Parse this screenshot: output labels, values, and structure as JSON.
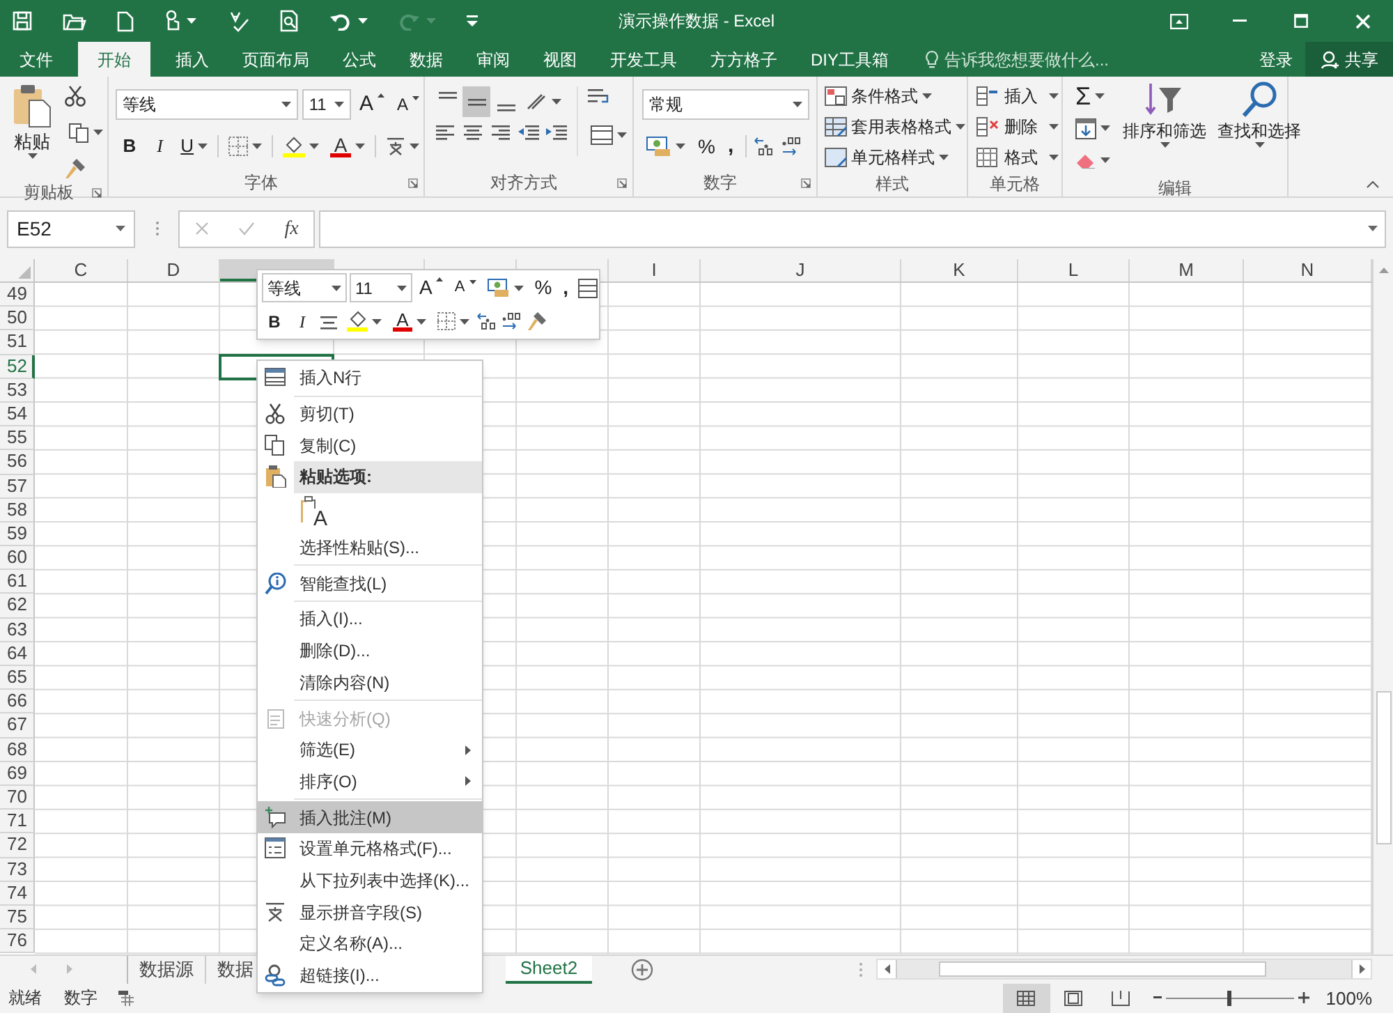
{
  "window": {
    "title": "演示操作数据 - Excel"
  },
  "ribbon_tabs": [
    {
      "label": "文件",
      "selected": false
    },
    {
      "label": "开始",
      "selected": true
    },
    {
      "label": "插入",
      "selected": false
    },
    {
      "label": "页面布局",
      "selected": false
    },
    {
      "label": "公式",
      "selected": false
    },
    {
      "label": "数据",
      "selected": false
    },
    {
      "label": "审阅",
      "selected": false
    },
    {
      "label": "视图",
      "selected": false
    },
    {
      "label": "开发工具",
      "selected": false
    },
    {
      "label": "方方格子",
      "selected": false
    },
    {
      "label": "DIY工具箱",
      "selected": false
    }
  ],
  "tell_me": {
    "placeholder": "告诉我您想要做什么..."
  },
  "account": {
    "sign_in": "登录",
    "share": "共享"
  },
  "ribbon": {
    "clipboard": {
      "label": "剪贴板",
      "paste": "粘贴"
    },
    "font": {
      "label": "字体",
      "font_name": "等线",
      "font_size": "11",
      "grow": "A",
      "shrink": "A",
      "bold": "B",
      "italic": "I",
      "underline": "U",
      "font_color": "A"
    },
    "alignment": {
      "label": "对齐方式",
      "vertical": [
        {
          "selected": false
        },
        {
          "selected": true
        },
        {
          "selected": false
        }
      ]
    },
    "number": {
      "label": "数字",
      "format": "常规",
      "percent": "%",
      "comma": ","
    },
    "styles": {
      "label": "样式",
      "buttons": [
        "条件格式",
        "套用表格格式",
        "单元格样式"
      ]
    },
    "cells": {
      "label": "单元格",
      "buttons": [
        "插入",
        "删除",
        "格式"
      ]
    },
    "editing": {
      "label": "编辑",
      "sum": "Σ",
      "buttons": [
        "排序和筛选",
        "查找和选择"
      ]
    }
  },
  "formula_bar": {
    "name_box": "E52",
    "function_button": "fx"
  },
  "sheet": {
    "columns": [
      {
        "label": "C",
        "selected": false
      },
      {
        "label": "D",
        "selected": false
      },
      {
        "selected": true
      },
      {
        "selected": false
      },
      {
        "selected": false
      },
      {
        "selected": false
      },
      {
        "label": "I",
        "selected": false
      },
      {
        "label": "J",
        "selected": false
      },
      {
        "label": "K",
        "selected": false
      },
      {
        "label": "L",
        "selected": false
      },
      {
        "label": "M",
        "selected": false
      },
      {
        "label": "N",
        "selected": false
      }
    ],
    "rows": [
      {
        "label": "49",
        "selected": false
      },
      {
        "label": "50",
        "selected": false
      },
      {
        "label": "51",
        "selected": false
      },
      {
        "label": "52",
        "selected": true
      },
      {
        "label": "53",
        "selected": false
      },
      {
        "label": "54",
        "selected": false
      },
      {
        "label": "55",
        "selected": false
      },
      {
        "label": "56",
        "selected": false
      },
      {
        "label": "57",
        "selected": false
      },
      {
        "label": "58",
        "selected": false
      },
      {
        "label": "59",
        "selected": false
      },
      {
        "label": "60",
        "selected": false
      },
      {
        "label": "61",
        "selected": false
      },
      {
        "label": "62",
        "selected": false
      },
      {
        "label": "63",
        "selected": false
      },
      {
        "label": "64",
        "selected": false
      },
      {
        "label": "65",
        "selected": false
      },
      {
        "label": "66",
        "selected": false
      },
      {
        "label": "67",
        "selected": false
      },
      {
        "label": "68",
        "selected": false
      },
      {
        "label": "69",
        "selected": false
      },
      {
        "label": "70",
        "selected": false
      },
      {
        "label": "71",
        "selected": false
      },
      {
        "label": "72",
        "selected": false
      },
      {
        "label": "73",
        "selected": false
      },
      {
        "label": "74",
        "selected": false
      },
      {
        "label": "75",
        "selected": false
      },
      {
        "label": "76",
        "selected": false
      }
    ]
  },
  "mini_toolbar": {
    "font_name": "等线",
    "font_size": "11",
    "grow": "A",
    "shrink": "A",
    "percent": "%",
    "comma": ",",
    "bold": "B",
    "italic": "I",
    "font_color": "A"
  },
  "context_menu": {
    "items": [
      {
        "kind": "item",
        "label": "插入N行",
        "selected": false,
        "disabled": false,
        "submenu": false
      },
      {
        "kind": "separator"
      },
      {
        "kind": "item",
        "label": "剪切(T)",
        "selected": false,
        "disabled": false,
        "submenu": false
      },
      {
        "kind": "item",
        "label": "复制(C)",
        "selected": false,
        "disabled": false,
        "submenu": false
      },
      {
        "kind": "header",
        "label": "粘贴选项:"
      },
      {
        "kind": "paste_option",
        "label": "A"
      },
      {
        "kind": "item",
        "label": "选择性粘贴(S)...",
        "selected": false,
        "disabled": false,
        "submenu": false
      },
      {
        "kind": "separator"
      },
      {
        "kind": "item",
        "label": "智能查找(L)",
        "selected": false,
        "disabled": false,
        "submenu": false
      },
      {
        "kind": "separator"
      },
      {
        "kind": "item",
        "label": "插入(I)...",
        "selected": false,
        "disabled": false,
        "submenu": false
      },
      {
        "kind": "item",
        "label": "删除(D)...",
        "selected": false,
        "disabled": false,
        "submenu": false
      },
      {
        "kind": "item",
        "label": "清除内容(N)",
        "selected": false,
        "disabled": false,
        "submenu": false
      },
      {
        "kind": "separator"
      },
      {
        "kind": "item",
        "label": "快速分析(Q)",
        "selected": false,
        "disabled": true,
        "submenu": false
      },
      {
        "kind": "item",
        "label": "筛选(E)",
        "selected": false,
        "disabled": false,
        "submenu": true
      },
      {
        "kind": "item",
        "label": "排序(O)",
        "selected": false,
        "disabled": false,
        "submenu": true
      },
      {
        "kind": "separator"
      },
      {
        "kind": "item",
        "label": "插入批注(M)",
        "selected": true,
        "disabled": false,
        "submenu": false
      },
      {
        "kind": "item",
        "label": "设置单元格格式(F)...",
        "selected": false,
        "disabled": false,
        "submenu": false
      },
      {
        "kind": "item",
        "label": "从下拉列表中选择(K)...",
        "selected": false,
        "disabled": false,
        "submenu": false
      },
      {
        "kind": "item",
        "label": "显示拼音字段(S)",
        "selected": false,
        "disabled": false,
        "submenu": false
      },
      {
        "kind": "item",
        "label": "定义名称(A)...",
        "selected": false,
        "disabled": false,
        "submenu": false
      },
      {
        "kind": "item",
        "label": "超链接(I)...",
        "selected": false,
        "disabled": false,
        "submenu": false
      }
    ]
  },
  "sheet_tabs": [
    {
      "label": "数据源",
      "selected": false
    },
    {
      "label": "数据",
      "selected": false
    },
    {
      "label": "Sheet2",
      "selected": true
    }
  ],
  "status_bar": {
    "items": [
      "就绪",
      "数字"
    ],
    "views": [
      {
        "selected": true
      },
      {
        "selected": false
      },
      {
        "selected": false
      }
    ],
    "zoom": {
      "level": 0.5,
      "reading": "100%"
    }
  }
}
